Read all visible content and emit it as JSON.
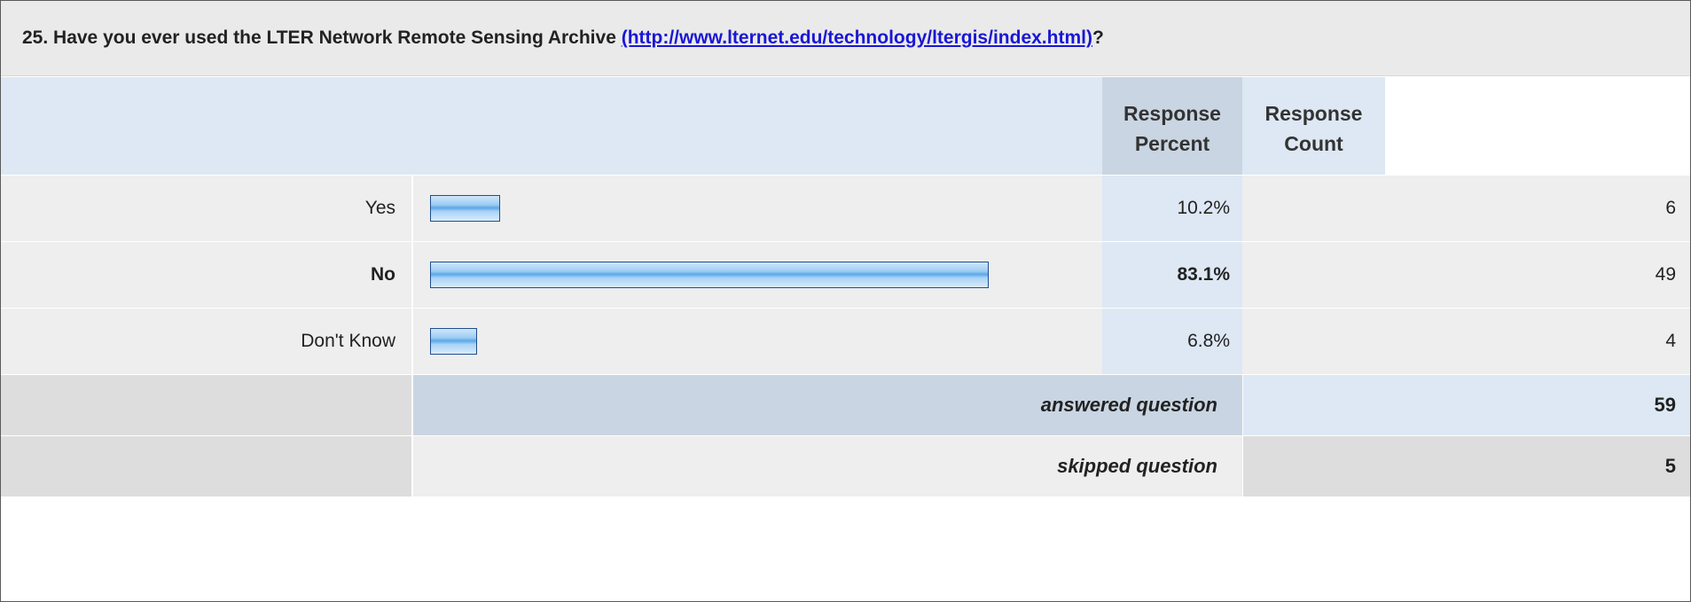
{
  "question": {
    "prefix": "25. Have you ever used the LTER Network Remote Sensing Archive ",
    "link_text": "(http://www.lternet.edu/technology/ltergis/index.html)",
    "suffix": "?"
  },
  "headers": {
    "percent_line1": "Response",
    "percent_line2": "Percent",
    "count_line1": "Response",
    "count_line2": "Count"
  },
  "rows": [
    {
      "label": "Yes",
      "percent": "10.2%",
      "count": "6",
      "fraction": 0.102,
      "bold": false
    },
    {
      "label": "No",
      "percent": "83.1%",
      "count": "49",
      "fraction": 0.831,
      "bold": true
    },
    {
      "label": "Don't Know",
      "percent": "6.8%",
      "count": "4",
      "fraction": 0.068,
      "bold": false
    }
  ],
  "summary": {
    "answered_label": "answered question",
    "answered_value": "59",
    "skipped_label": "skipped question",
    "skipped_value": "5"
  },
  "colors": {
    "bar_border": "#1f4e8c",
    "header_blue": "#dde8f4",
    "header_dark_blue": "#c9d5e2",
    "link_blue": "#1a16d6"
  }
}
